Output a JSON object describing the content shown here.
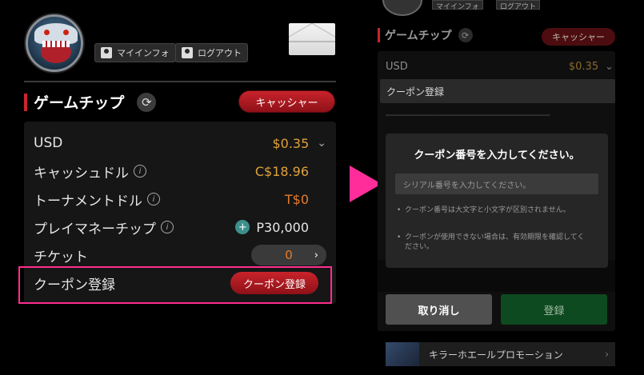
{
  "left": {
    "header": {
      "my_info_label": "マイインフォ",
      "logout_label": "ログアウト"
    },
    "section_title": "ゲームチップ",
    "cashier_label": "キャッシャー",
    "rows": {
      "usd": {
        "label": "USD",
        "value": "$0.35"
      },
      "cash": {
        "label": "キャッシュドル",
        "value": "C$18.96"
      },
      "tourney": {
        "label": "トーナメントドル",
        "value": "T$0"
      },
      "play": {
        "label": "プレイマネーチップ",
        "value": "P30,000"
      },
      "ticket": {
        "label": "チケット",
        "value": "0"
      },
      "coupon": {
        "label": "クーポン登録",
        "button": "クーポン登録"
      }
    }
  },
  "right": {
    "header": {
      "my_info_label": "マイインフォ",
      "logout_label": "ログアウト"
    },
    "section_title": "ゲームチップ",
    "cashier_label": "キャッシャー",
    "usd": {
      "label": "USD",
      "value": "$0.35"
    },
    "dropdown_label": "クーポン登録",
    "dialog": {
      "title": "クーポン番号を入力してください。",
      "placeholder": "シリアル番号を入力してください。",
      "note1": "クーポン番号は大文字と小文字が区別されません。",
      "note2": "クーポンが使用できない場合は、有効期限を確認してください。"
    },
    "cancel_label": "取り消し",
    "register_label": "登録",
    "promo_label": "キラーホエールプロモーション"
  },
  "colors": {
    "accent_red": "#c8232b",
    "highlight_pink": "#ff2d8f",
    "gold": "#e0a23a",
    "ok_green": "#0e4a20"
  }
}
